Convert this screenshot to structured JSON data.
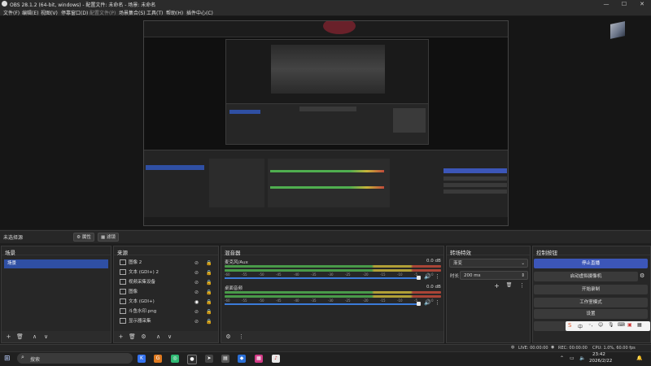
{
  "window": {
    "title": "OBS 28.1.2 (64-bit, windows) - 配置文件: 未命名 - 场景: 未命名",
    "minimize": "—",
    "maximize": "☐",
    "close": "✕"
  },
  "menu": [
    {
      "label": "文件(F)",
      "disabled": false
    },
    {
      "label": "编辑(E)",
      "disabled": false
    },
    {
      "label": "视图(V)",
      "disabled": false
    },
    {
      "label": "停靠窗口(D)",
      "disabled": false
    },
    {
      "label": "配置文件(P)",
      "disabled": true
    },
    {
      "label": "场景集合(S)",
      "disabled": false
    },
    {
      "label": "工具(T)",
      "disabled": false
    },
    {
      "label": "帮助(H)",
      "disabled": false
    },
    {
      "label": "插件中心(C)",
      "disabled": false
    }
  ],
  "source_bar": {
    "no_source": "未选择源",
    "properties": "属性",
    "filters": "滤镜"
  },
  "scenes": {
    "title": "场景",
    "items": [
      "场景"
    ]
  },
  "sources": {
    "title": "来源",
    "items": [
      {
        "label": "图像 2",
        "visible": false
      },
      {
        "label": "文本 (GDI+) 2",
        "visible": false
      },
      {
        "label": "视频采集设备",
        "visible": false
      },
      {
        "label": "图像",
        "visible": false
      },
      {
        "label": "文本 (GDI+)",
        "visible": true
      },
      {
        "label": "斗鱼水印.png",
        "visible": false
      },
      {
        "label": "显示器采集",
        "visible": false
      }
    ]
  },
  "mixer": {
    "title": "混音器",
    "channels": [
      {
        "name": "麦克风/Aux",
        "db": "0.0 dB",
        "volume": 0.94
      },
      {
        "name": "桌面音频",
        "db": "0.0 dB",
        "volume": 0.94
      }
    ],
    "ticks": [
      "-60",
      "-55",
      "-50",
      "-45",
      "-40",
      "-35",
      "-30",
      "-25",
      "-20",
      "-15",
      "-10",
      "-5",
      "0"
    ]
  },
  "transitions": {
    "title": "转场特效",
    "type": "渐变",
    "duration_label": "时长",
    "duration_value": "200 ms"
  },
  "controls": {
    "title": "控制按钮",
    "buttons": [
      {
        "label": "停止直播",
        "active": true
      },
      {
        "label": "启动虚拟摄像机",
        "active": false
      },
      {
        "label": "开始录制",
        "active": false
      },
      {
        "label": "工作室模式",
        "active": false
      },
      {
        "label": "设置",
        "active": false
      },
      {
        "label": "退出",
        "active": false
      }
    ]
  },
  "status": {
    "live": "LIVE: 00:00:00",
    "rec": "REC: 00:00:00",
    "cpu": "CPU: 1.0%, 60.00 fps"
  },
  "taskbar": {
    "search": "搜索",
    "time": "23:42",
    "date": "2026/2/22"
  },
  "colors": {
    "accent": "#2f4fa3",
    "live_button": "#3c56b8",
    "meter_green": "#4fae4f",
    "meter_yellow": "#c8b43a",
    "meter_red": "#c04a3a",
    "volume_blue": "#3b7bd9"
  }
}
